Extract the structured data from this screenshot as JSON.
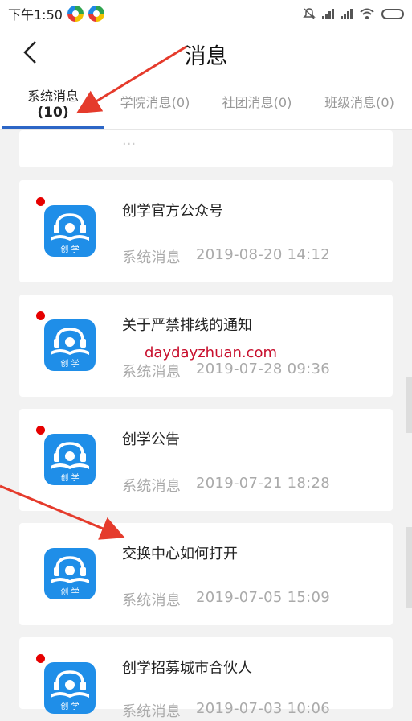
{
  "status": {
    "time": "下午1:50"
  },
  "header": {
    "title": "消息"
  },
  "tabs": [
    {
      "label": "系统消息",
      "count": "(10)"
    },
    {
      "label": "学院消息(0)"
    },
    {
      "label": "社团消息(0)"
    },
    {
      "label": "班级消息(0)"
    }
  ],
  "partial_top": {
    "title": "...",
    "unread": false
  },
  "messages": [
    {
      "title": "创学官方公众号",
      "source": "系统消息",
      "time": "2019-08-20 14:12",
      "unread": true
    },
    {
      "title": "关于严禁排线的通知",
      "source": "系统消息",
      "time": "2019-07-28 09:36",
      "unread": true
    },
    {
      "title": "创学公告",
      "source": "系统消息",
      "time": "2019-07-21 18:28",
      "unread": true
    },
    {
      "title": "交换中心如何打开",
      "source": "系统消息",
      "time": "2019-07-05 15:09",
      "unread": false
    },
    {
      "title": "创学招募城市合伙人",
      "source": "系统消息",
      "time": "2019-07-03 10:06",
      "unread": true
    }
  ],
  "app_icon": {
    "icon": "chuangxue-app-icon",
    "label": "创 学",
    "color": "#1f8ee8"
  },
  "watermark": "daydayzhuan.com",
  "colors": {
    "accent": "#2c66c6",
    "unread_dot": "#e60000",
    "annotation_arrow": "#e53b2c"
  }
}
